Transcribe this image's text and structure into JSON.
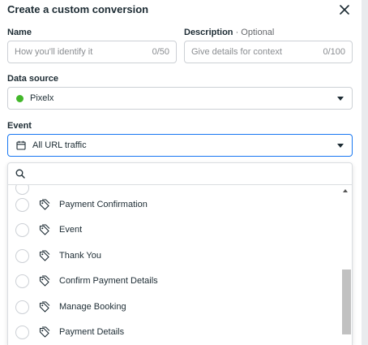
{
  "dialog": {
    "title": "Create a custom conversion"
  },
  "name_field": {
    "label": "Name",
    "placeholder": "How you'll identify it",
    "counter": "0/50"
  },
  "description_field": {
    "label": "Description",
    "optional": "· Optional",
    "placeholder": "Give details for context",
    "counter": "0/100"
  },
  "data_source": {
    "label": "Data source",
    "value": "Pixelx",
    "status_color": "#42b72a"
  },
  "event": {
    "label": "Event",
    "value": "All URL traffic"
  },
  "dropdown": {
    "search_placeholder": "",
    "items": [
      {
        "label": "Payment Confirmation"
      },
      {
        "label": "Event"
      },
      {
        "label": "Thank You"
      },
      {
        "label": "Confirm Payment Details"
      },
      {
        "label": "Manage Booking"
      },
      {
        "label": "Payment Details"
      }
    ]
  },
  "colors": {
    "accent": "#1877f2",
    "text": "#1c2b33",
    "muted": "#8a8d91"
  }
}
